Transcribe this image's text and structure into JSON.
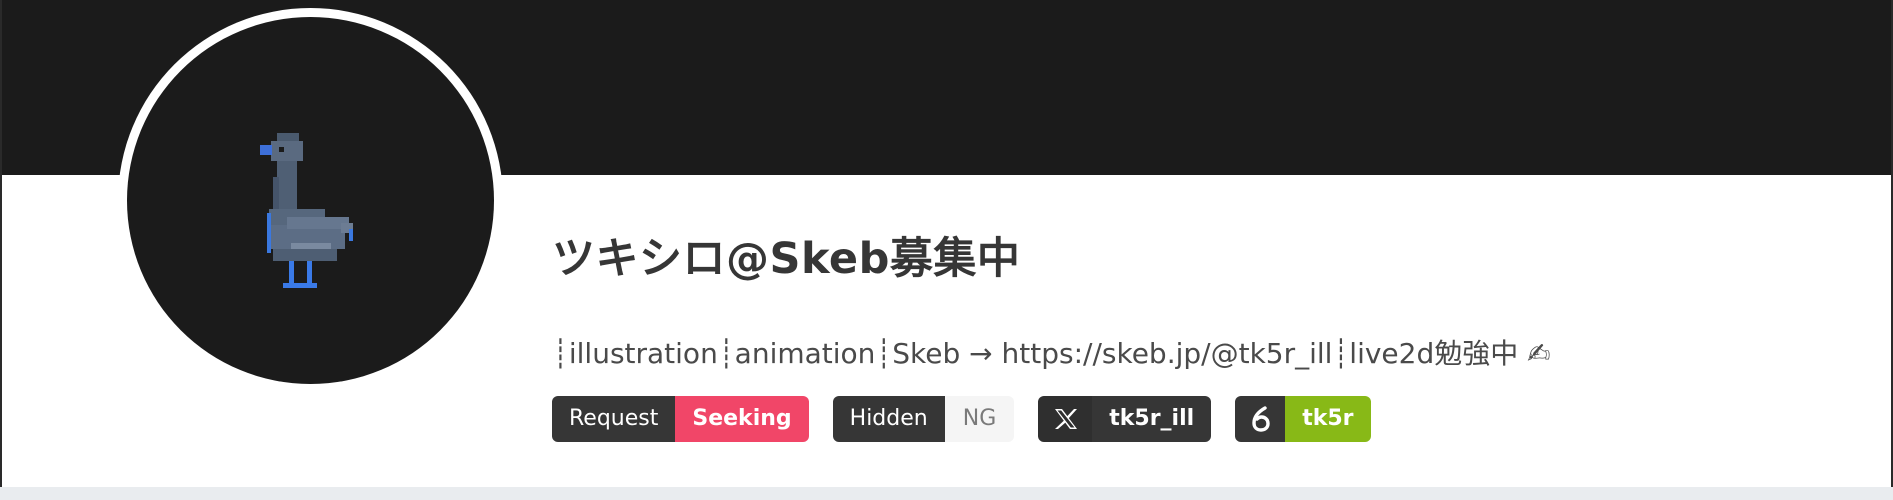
{
  "profile": {
    "display_name": "ツキシロ@Skeb募集中",
    "bio": "┊illustration┊animation┊Skeb → https://skeb.jp/@tk5r_ill┊live2d勉強中 ✍"
  },
  "avatar": {
    "icon": "pixel-goose-icon",
    "background": "#1b1b1b"
  },
  "cover": {
    "color": "#1b1b1b"
  },
  "tags": {
    "request": {
      "label": "Request",
      "value": "Seeking",
      "color": "#f14668"
    },
    "hidden": {
      "label": "Hidden",
      "value": "NG"
    },
    "x": {
      "icon": "x-logo-icon",
      "value": "tk5r_ill"
    },
    "pixiv": {
      "icon": "pixiv-logo-icon",
      "value": "tk5r",
      "color": "#88b917"
    }
  }
}
